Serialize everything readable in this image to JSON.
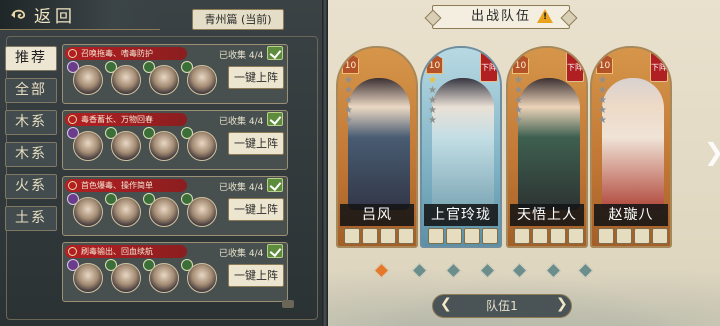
{
  "header": {
    "back_label": "返回",
    "region_label": "青州篇 (当前)"
  },
  "categories": [
    {
      "label": "推荐",
      "active": true
    },
    {
      "label": "全部",
      "active": false
    },
    {
      "label": "木系",
      "active": false
    },
    {
      "label": "木系",
      "active": false
    },
    {
      "label": "火系",
      "active": false
    },
    {
      "label": "土系",
      "active": false
    }
  ],
  "teams": [
    {
      "label": "召唤拖毒、嗜毒防护",
      "collected": "已收集 4/4",
      "button": "一键上阵"
    },
    {
      "label": "毒香蓄长、万物回春",
      "collected": "已收集 4/4",
      "button": "一键上阵"
    },
    {
      "label": "首色爆毒、操作简单",
      "collected": "已收集 4/4",
      "button": "一键上阵"
    },
    {
      "label": "刷毒输出、回血续航",
      "collected": "已收集 4/4",
      "button": "一键上阵"
    }
  ],
  "battle": {
    "title": "出战队伍",
    "warning_icon": "warning-triangle-icon",
    "warning_mark": "!",
    "remove_label": "下阵",
    "remove_x": "✕",
    "star_glyph": "★",
    "heroes": [
      {
        "name": "吕风",
        "level": "10",
        "stars": 0,
        "removable": false,
        "theme": "orange"
      },
      {
        "name": "上官玲珑",
        "level": "10",
        "stars": 1,
        "removable": true,
        "theme": "blue"
      },
      {
        "name": "天悟上人",
        "level": "10",
        "stars": 0,
        "removable": true,
        "theme": "orange"
      },
      {
        "name": "赵璇八",
        "level": "10",
        "stars": 0,
        "removable": true,
        "theme": "orange"
      }
    ],
    "team_selector": "队伍1",
    "prev_arrow": "❮",
    "next_arrow": "❯",
    "page_next": "❯",
    "page_dots": 7,
    "active_dot": 0
  },
  "colors": {
    "accent_red": "#b41f22",
    "gold_border": "#8d7b55",
    "active_dot": "#e6782a"
  }
}
